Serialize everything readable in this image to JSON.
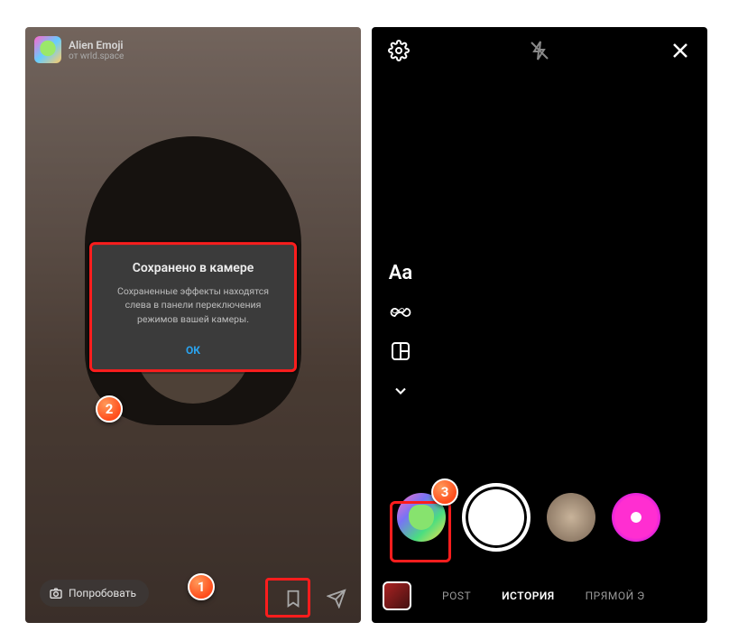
{
  "left": {
    "effect": {
      "name": "Alien Emoji",
      "author_line": "от wrld.space"
    },
    "dialog": {
      "title": "Сохранено в камере",
      "body": "Сохраненные эффекты находятся слева в панели переключения режимов вашей камеры.",
      "ok": "ОК"
    },
    "try_button": "Попробовать",
    "icons": {
      "camera": "camera-icon",
      "save": "bookmark-icon",
      "send": "send-icon"
    }
  },
  "right": {
    "top": {
      "settings": "settings-icon",
      "flash": "flash-off-icon",
      "close": "close-icon"
    },
    "tools": {
      "text": "Aa",
      "boomerang": "infinity-icon",
      "layout": "layout-icon",
      "more": "chevron-down-icon"
    },
    "effects": [
      {
        "name": "alien-emoji-effect"
      },
      {
        "name": "shutter-button"
      },
      {
        "name": "sepia-portrait-effect"
      },
      {
        "name": "pink-alien-effect"
      }
    ],
    "modes": {
      "gallery": "gallery-thumbnail",
      "post": "POST",
      "story": "ИСТОРИЯ",
      "live": "ПРЯМОЙ Э"
    }
  },
  "annotations": {
    "b1": "1",
    "b2": "2",
    "b3": "3"
  },
  "colors": {
    "highlight": "#ff1d1d",
    "ok_link": "#2aa3ef"
  }
}
